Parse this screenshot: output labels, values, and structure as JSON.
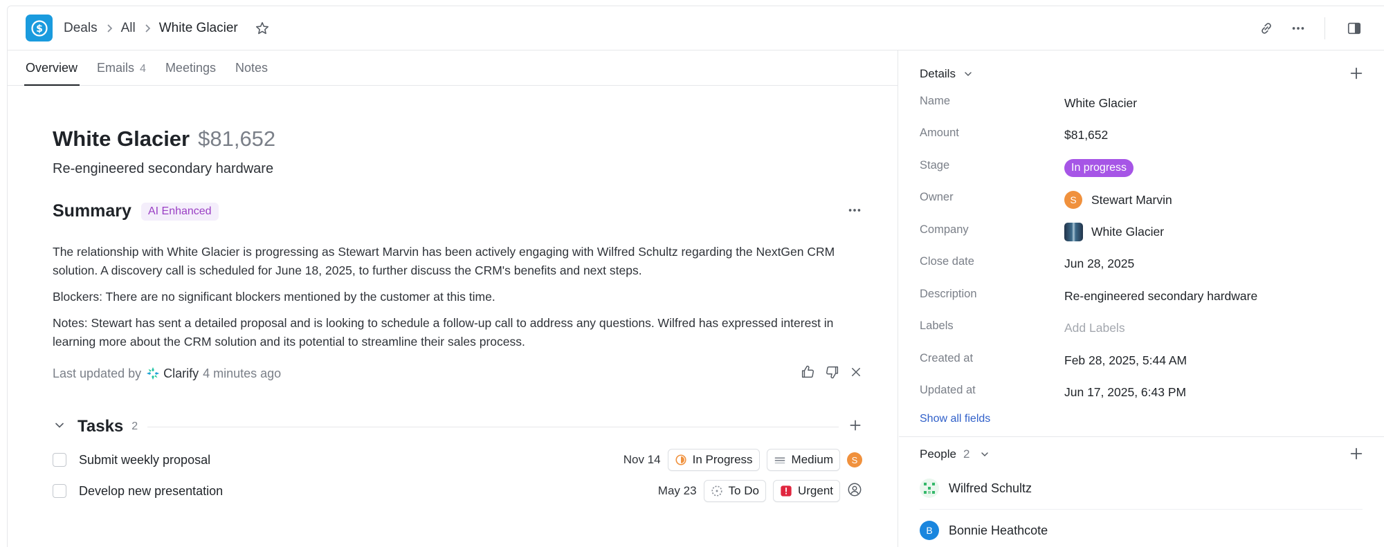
{
  "header": {
    "breadcrumb": [
      "Deals",
      "All",
      "White Glacier"
    ]
  },
  "tabs": [
    {
      "label": "Overview",
      "count": ""
    },
    {
      "label": "Emails",
      "count": "4"
    },
    {
      "label": "Meetings",
      "count": ""
    },
    {
      "label": "Notes",
      "count": ""
    }
  ],
  "deal": {
    "name": "White Glacier",
    "amount": "$81,652",
    "description": "Re-engineered secondary hardware"
  },
  "summary": {
    "title": "Summary",
    "badge": "AI Enhanced",
    "paragraphs": [
      "The relationship with White Glacier is progressing as Stewart Marvin has been actively engaging with Wilfred Schultz regarding the NextGen CRM solution. A discovery call is scheduled for June 18, 2025, to further discuss the CRM's benefits and next steps.",
      "Blockers: There are no significant blockers mentioned by the customer at this time.",
      "Notes: Stewart has sent a detailed proposal and is looking to schedule a follow-up call to address any questions. Wilfred has expressed interest in learning more about the CRM solution and its potential to streamline their sales process."
    ],
    "updated_prefix": "Last updated by",
    "updated_by": "Clarify",
    "updated_ago": "4 minutes ago"
  },
  "tasks": {
    "title": "Tasks",
    "count": "2",
    "items": [
      {
        "name": "Submit weekly proposal",
        "due": "Nov 14",
        "status": "In Progress",
        "priority": "Medium",
        "assignee_initial": "S"
      },
      {
        "name": "Develop new presentation",
        "due": "May 23",
        "status": "To Do",
        "priority": "Urgent",
        "assignee_initial": ""
      }
    ]
  },
  "details": {
    "title": "Details",
    "fields": [
      {
        "label": "Name",
        "value": "White Glacier"
      },
      {
        "label": "Amount",
        "value": "$81,652"
      },
      {
        "label": "Stage",
        "value": "In progress"
      },
      {
        "label": "Owner",
        "value": "Stewart Marvin",
        "initial": "S"
      },
      {
        "label": "Company",
        "value": "White Glacier"
      },
      {
        "label": "Close date",
        "value": "Jun 28, 2025"
      },
      {
        "label": "Description",
        "value": "Re-engineered secondary hardware"
      },
      {
        "label": "Labels",
        "value": "Add Labels"
      },
      {
        "label": "Created at",
        "value": "Feb 28, 2025, 5:44 AM"
      },
      {
        "label": "Updated at",
        "value": "Jun 17, 2025, 6:43 PM"
      }
    ],
    "show_all": "Show all fields"
  },
  "people": {
    "title": "People",
    "count": "2",
    "items": [
      {
        "name": "Wilfred Schultz",
        "initial": ""
      },
      {
        "name": "Bonnie Heathcote",
        "initial": "B"
      }
    ]
  },
  "colors": {
    "accent": "#1a9bde",
    "stage": "#a655e6",
    "owner": "#f0913d",
    "link": "#2f5fc9",
    "ai_badge": "#9a3fc4"
  }
}
